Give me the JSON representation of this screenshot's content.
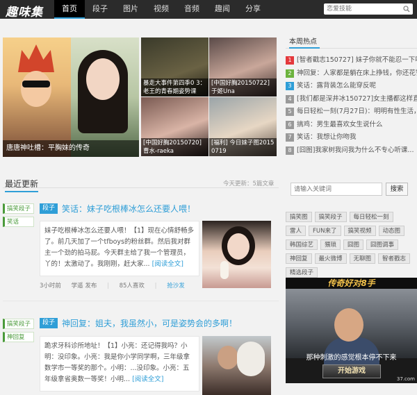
{
  "site": {
    "logo": "趣味集"
  },
  "nav": {
    "items": [
      "首页",
      "段子",
      "图片",
      "视频",
      "音频",
      "趣闻",
      "分享"
    ],
    "active": 0
  },
  "search_top": {
    "placeholder": "恋爱技能"
  },
  "hero": {
    "caption": "唐唐神吐槽：平胸妹的传奇"
  },
  "tiles": [
    {
      "caption": "暴走大事件第四季0 3：老王的青春期姿势课"
    },
    {
      "caption": "[中国好胸20150722] 于姬Una"
    },
    {
      "caption": "[中国好胸20150720] 曹水-raeka"
    },
    {
      "caption": "[福利] 今日妹子图2015 0719"
    }
  ],
  "hot": {
    "title": "本周热点",
    "items": [
      {
        "num": "1",
        "text": "[智者戳志150727] 妹子你就不能忍一下吗"
      },
      {
        "num": "2",
        "text": "神回复：人家都是躺在床上挣钱，你还花钱"
      },
      {
        "num": "3",
        "text": "笑话：露背装怎么能穿反呢"
      },
      {
        "num": "4",
        "text": "[我们都是深井冰150727]女主播都这样直播"
      },
      {
        "num": "5",
        "text": "每日轻松一刻(7月27日)：明明有性生活，却"
      },
      {
        "num": "6",
        "text": "搞鸡：男生最喜欢女生说什么"
      },
      {
        "num": "7",
        "text": "笑话：我想让你吻我"
      },
      {
        "num": "8",
        "text": "[囧图]我家树我问我为什么不专心听课..."
      }
    ]
  },
  "latest": {
    "title": "最近更新",
    "count": "今天更新：5篇文章"
  },
  "posts": [
    {
      "tags": [
        "搞笑段子",
        "笑话"
      ],
      "category": "段子",
      "title": "笑话：妹子吃根棒冰怎么还要人喂！",
      "body": "妹子吃根棒冰怎么还要人喂！【1】现在心情舒畅多了。前几天加了一个tfboys的粉丝群。然后我对群主一个劲的拍马屁。今天群主给了我一个管理员，丫的！太激动了。我刚刚，赶大家...",
      "more": "[阅读全文]",
      "time": "3小时前",
      "author": "学遥 发布",
      "likes": "85人喜欢",
      "reply": "抢沙发"
    },
    {
      "tags": [
        "搞笑段子",
        "神回复"
      ],
      "category": "段子",
      "title": "神回复：姐夫，我虽然小，可是姿势会的多啊！",
      "body": "跪求牙科诊所地址！【1】小亮：还记得我吗？小明：没印象。小亮：我是你小学同学啊，三年级拿数学市一等奖的那个。小明：...没印象。小亮：五年级拿省奥数一等奖！小明...",
      "more": "[阅读全文]"
    }
  ],
  "right_search": {
    "placeholder": "请输入关键词",
    "button": "搜索"
  },
  "tag_cloud": [
    "搞笑图",
    "搞笑段子",
    "每日轻松一刻",
    "雷人",
    "FUN来了",
    "搞笑视频",
    "动态图",
    "韩国综艺",
    "猥琐",
    "囧图",
    "囧图调事",
    "神回复",
    "最火微博",
    "无聊图",
    "智者戳志",
    "精选段子"
  ],
  "ad": {
    "headline": "传奇好对8手",
    "subtitle": "那种刺激的感觉根本停不下来",
    "button": "开始游戏",
    "site": "37.com"
  }
}
